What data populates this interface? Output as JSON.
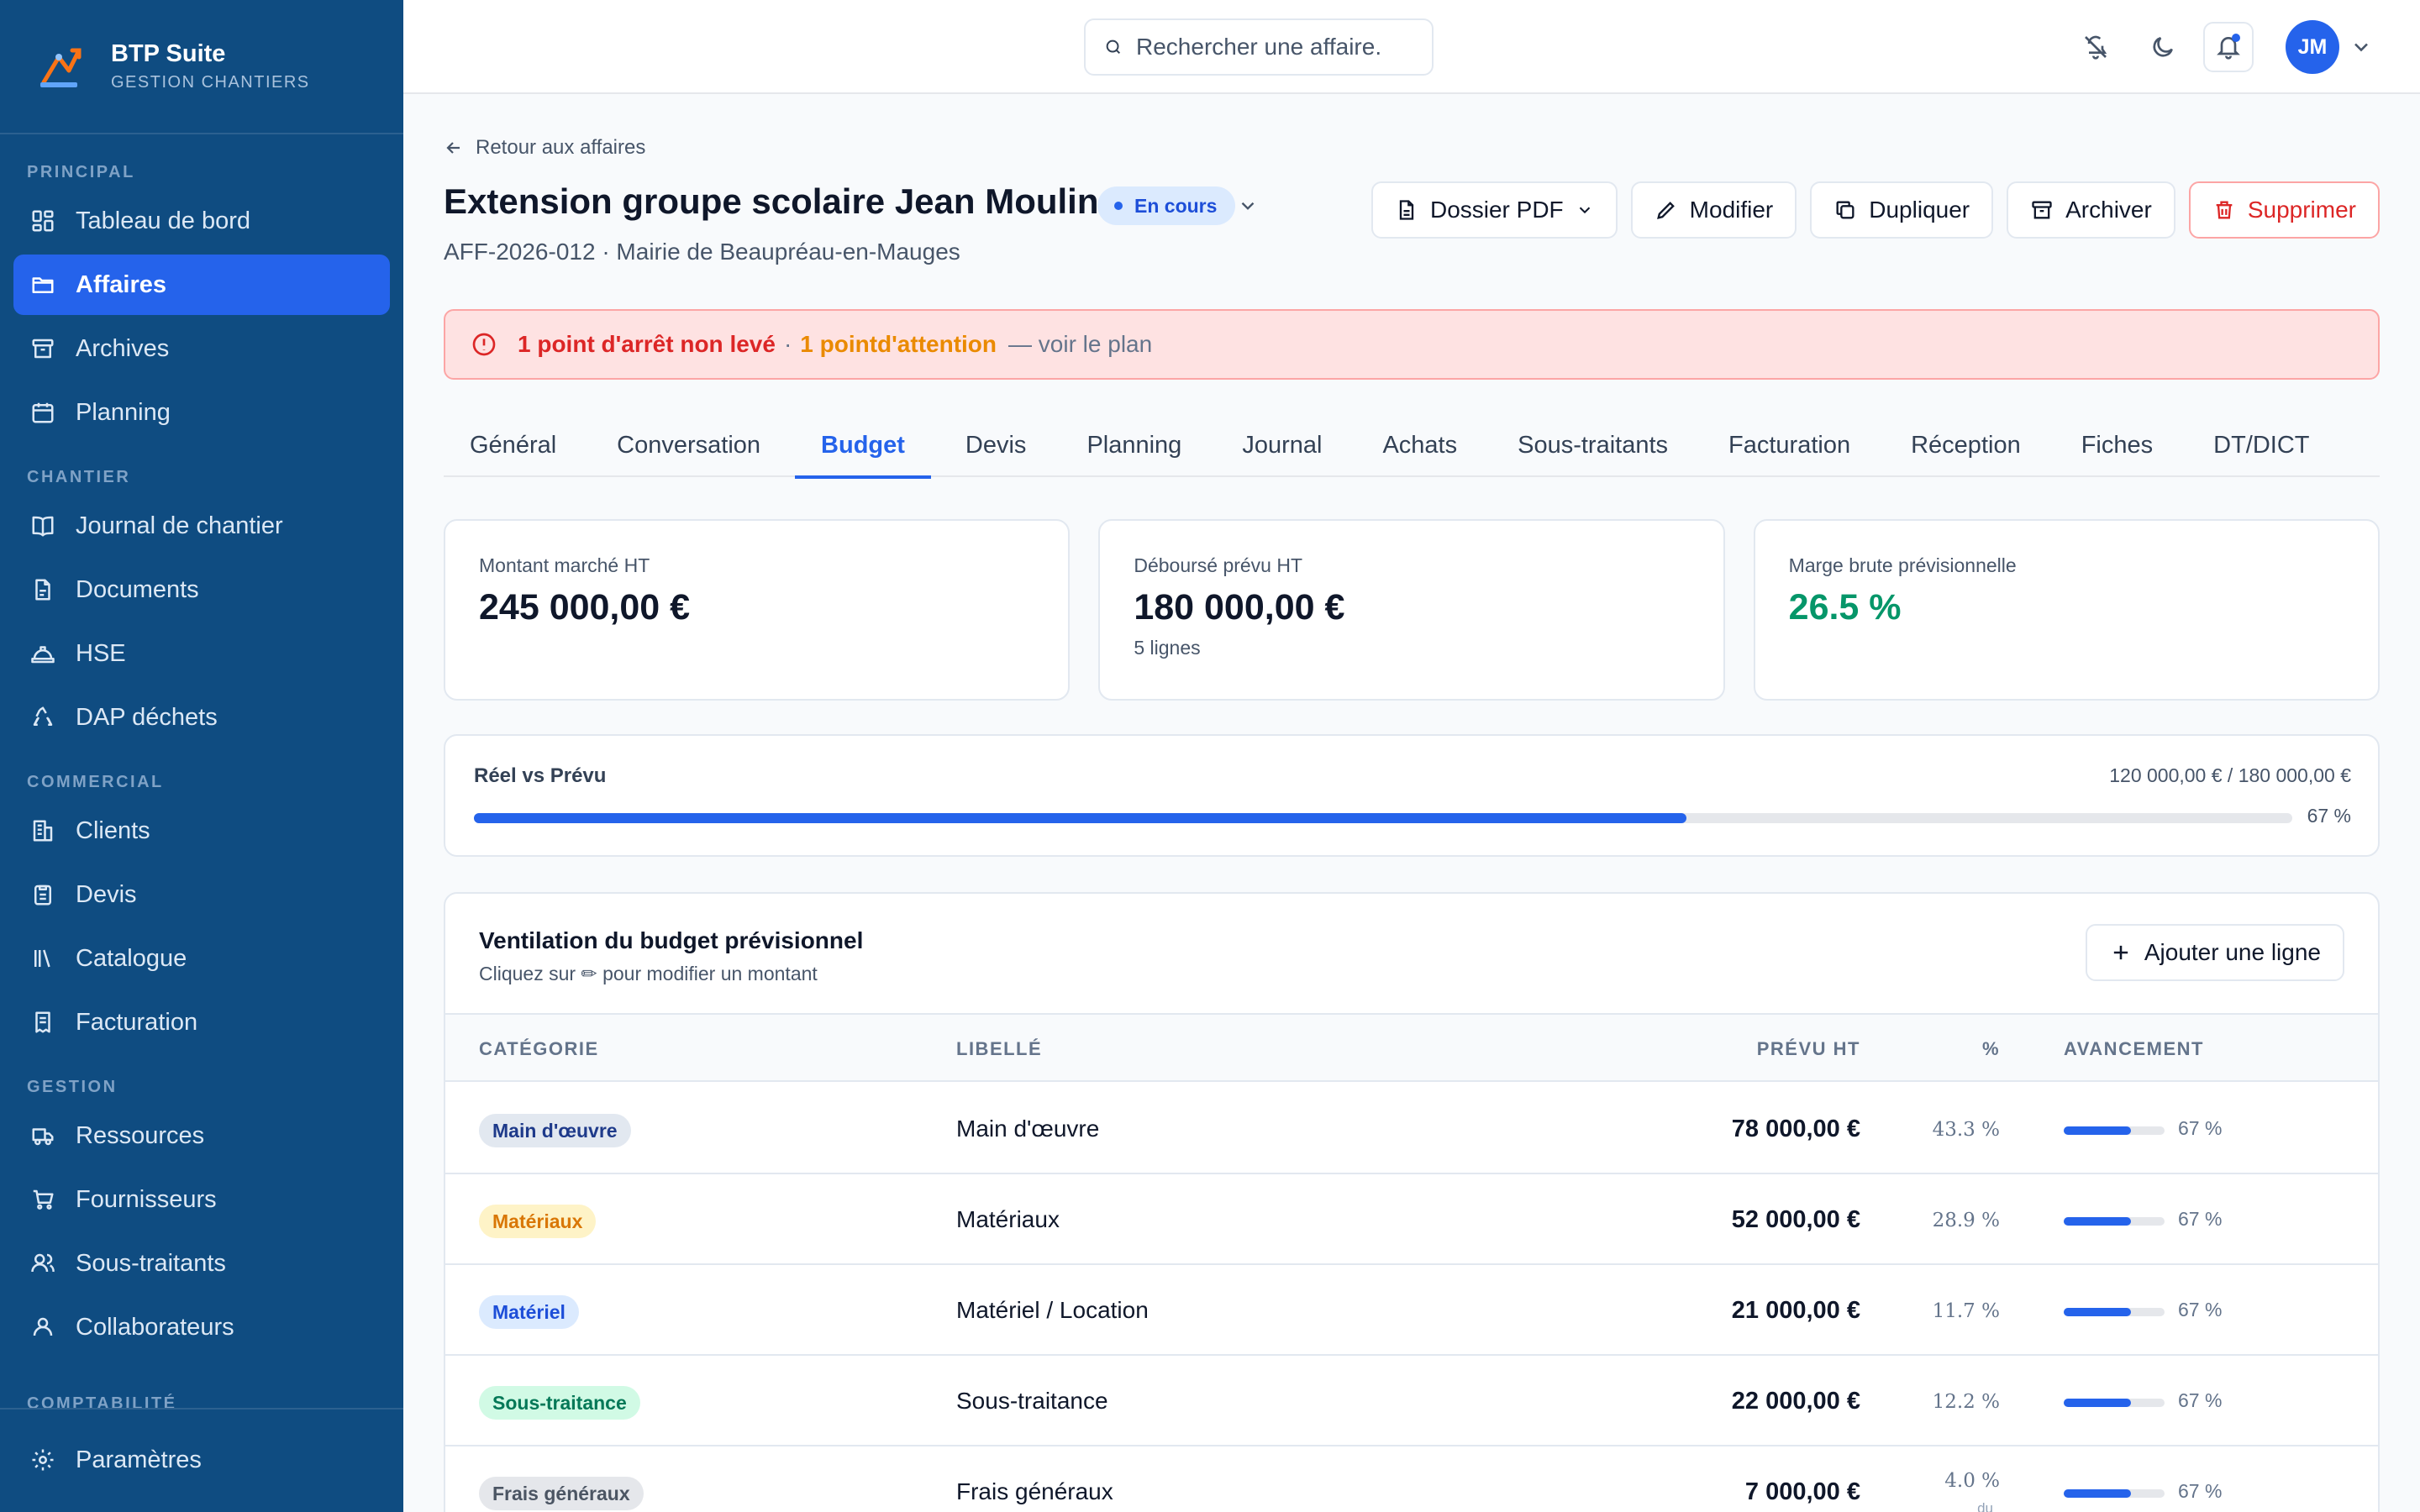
{
  "brand": {
    "name": "BTP Suite",
    "subtitle": "GESTION CHANTIERS"
  },
  "sidebar": {
    "sections": [
      {
        "title": "PRINCIPAL",
        "items": [
          {
            "label": "Tableau de bord",
            "icon": "dashboard-icon"
          },
          {
            "label": "Affaires",
            "icon": "folder-icon",
            "active": true
          },
          {
            "label": "Archives",
            "icon": "archive-icon"
          },
          {
            "label": "Planning",
            "icon": "calendar-icon"
          }
        ]
      },
      {
        "title": "CHANTIER",
        "items": [
          {
            "label": "Journal de chantier",
            "icon": "book-icon"
          },
          {
            "label": "Documents",
            "icon": "document-icon"
          },
          {
            "label": "HSE",
            "icon": "helmet-icon"
          },
          {
            "label": "DAP déchets",
            "icon": "recycle-icon"
          }
        ]
      },
      {
        "title": "COMMERCIAL",
        "items": [
          {
            "label": "Clients",
            "icon": "building-icon"
          },
          {
            "label": "Devis",
            "icon": "clipboard-icon"
          },
          {
            "label": "Catalogue",
            "icon": "library-icon"
          },
          {
            "label": "Facturation",
            "icon": "invoice-icon"
          }
        ]
      },
      {
        "title": "GESTION",
        "items": [
          {
            "label": "Ressources",
            "icon": "truck-icon"
          },
          {
            "label": "Fournisseurs",
            "icon": "cart-icon"
          },
          {
            "label": "Sous-traitants",
            "icon": "users-icon"
          },
          {
            "label": "Collaborateurs",
            "icon": "user-icon"
          }
        ]
      }
    ],
    "cut_section": "COMPTABILITÉ",
    "settings_label": "Paramètres"
  },
  "topbar": {
    "search_placeholder": "Rechercher une affaire.",
    "avatar_initials": "JM"
  },
  "header": {
    "back_label": "Retour aux affaires",
    "title": "Extension groupe scolaire Jean Moulin",
    "status": "En cours",
    "subtitle": "AFF-2026-012 · Mairie de Beaupréau-en-Mauges",
    "actions": {
      "pdf": "Dossier PDF",
      "edit": "Modifier",
      "duplicate": "Dupliquer",
      "archive": "Archiver",
      "delete": "Supprimer"
    }
  },
  "alert": {
    "stop": "1 point d'arrêt non levé",
    "sep": "·",
    "attention": "1 pointd'attention",
    "link": "— voir le plan"
  },
  "tabs": [
    "Général",
    "Conversation",
    "Budget",
    "Devis",
    "Planning",
    "Journal",
    "Achats",
    "Sous-traitants",
    "Facturation",
    "Réception",
    "Fiches",
    "DT/DICT"
  ],
  "active_tab": "Budget",
  "kpis": [
    {
      "label": "Montant marché HT",
      "value": "245 000,00 €",
      "sub": ""
    },
    {
      "label": "Déboursé prévu HT",
      "value": "180 000,00 €",
      "sub": "5 lignes"
    },
    {
      "label": "Marge brute prévisionnelle",
      "value": "26.5 %",
      "sub": "",
      "color": "#059669"
    }
  ],
  "progress": {
    "label": "Réel vs Prévu",
    "amount": "120 000,00 € / 180 000,00 €",
    "percent_label": "67 %",
    "fraction": 0.667
  },
  "budget_table": {
    "title": "Ventilation du budget prévisionnel",
    "subtitle": "Cliquez sur ✏ pour modifier un montant",
    "add_label": "Ajouter une ligne",
    "headers": {
      "category": "CATÉGORIE",
      "label": "LIBELLÉ",
      "planned": "PRÉVU HT",
      "percent": "%",
      "progress": "AVANCEMENT"
    },
    "rows": [
      {
        "category": "Main d'œuvre",
        "cat_bg": "#e2e8f0",
        "cat_fg": "#1e3a8a",
        "label": "Main d'œuvre",
        "amount": "78 000,00 €",
        "percent": "43.3 %",
        "progress": "67 %",
        "fraction": 0.67
      },
      {
        "category": "Matériaux",
        "cat_bg": "#fef3c7",
        "cat_fg": "#d97706",
        "label": "Matériaux",
        "amount": "52 000,00 €",
        "percent": "28.9 %",
        "progress": "67 %",
        "fraction": 0.67
      },
      {
        "category": "Matériel",
        "cat_bg": "#dbeafe",
        "cat_fg": "#1d4ed8",
        "label": "Matériel / Location",
        "amount": "21 000,00 €",
        "percent": "11.7 %",
        "progress": "67 %",
        "fraction": 0.67
      },
      {
        "category": "Sous-traitance",
        "cat_bg": "#d1fae5",
        "cat_fg": "#047857",
        "label": "Sous-traitance",
        "amount": "22 000,00 €",
        "percent": "12.2 %",
        "progress": "67 %",
        "fraction": 0.67
      },
      {
        "category": "Frais généraux",
        "cat_bg": "#e5e7eb",
        "cat_fg": "#4b5563",
        "label": "Frais généraux",
        "amount": "7 000,00 €",
        "percent": "4.0 %",
        "percent_note": "du",
        "progress": "67 %",
        "fraction": 0.67
      }
    ]
  }
}
